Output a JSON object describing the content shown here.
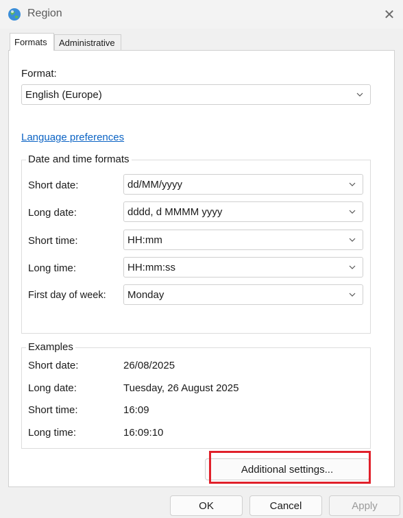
{
  "window": {
    "title": "Region"
  },
  "tabs": [
    {
      "label": "Formats",
      "active": true
    },
    {
      "label": "Administrative",
      "active": false
    }
  ],
  "format": {
    "label": "Format:",
    "value": "English (Europe)"
  },
  "language_link": "Language preferences",
  "date_time_formats": {
    "title": "Date and time formats",
    "rows": [
      {
        "label": "Short date:",
        "value": "dd/MM/yyyy"
      },
      {
        "label": "Long date:",
        "value": "dddd, d MMMM yyyy"
      },
      {
        "label": "Short time:",
        "value": "HH:mm"
      },
      {
        "label": "Long time:",
        "value": "HH:mm:ss"
      },
      {
        "label": "First day of week:",
        "value": "Monday"
      }
    ]
  },
  "examples": {
    "title": "Examples",
    "rows": [
      {
        "label": "Short date:",
        "value": "26/08/2025"
      },
      {
        "label": "Long date:",
        "value": "Tuesday, 26 August 2025"
      },
      {
        "label": "Short time:",
        "value": "16:09"
      },
      {
        "label": "Long time:",
        "value": "16:09:10"
      }
    ]
  },
  "buttons": {
    "additional_settings": "Additional settings...",
    "ok": "OK",
    "cancel": "Cancel",
    "apply": "Apply"
  },
  "colors": {
    "link": "#0b63c4",
    "highlight": "#e0202a"
  }
}
